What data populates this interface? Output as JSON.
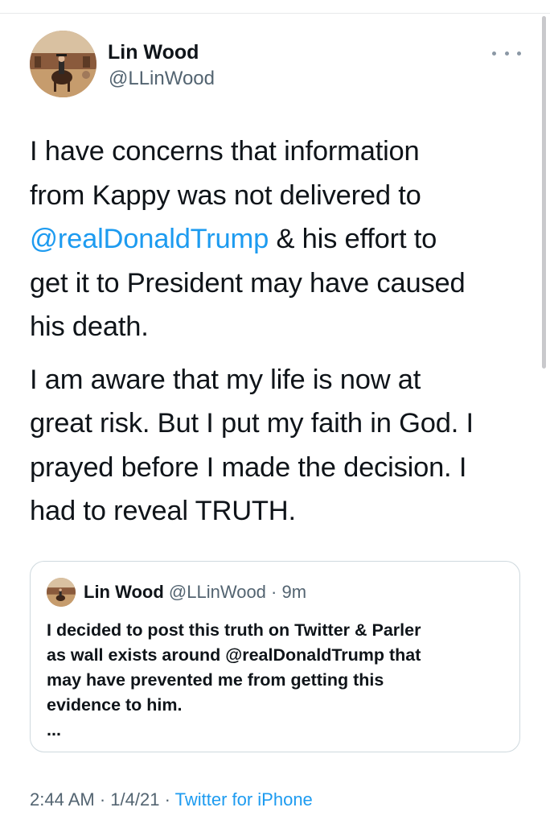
{
  "author": {
    "name": "Lin Wood",
    "handle": "@LLinWood"
  },
  "tweet": {
    "paragraph1": {
      "line1": "I have concerns that information",
      "line2": "from Kappy was not delivered to",
      "line3_mention": "@realDonaldTrump",
      "line3_rest": " & his effort to",
      "line4": "get it to President may have caused",
      "line5": "his death."
    },
    "paragraph2": {
      "line1": "I am aware that my life is now at",
      "line2": "great risk. But I put my faith in God. I",
      "line3": "prayed before I made the decision. I",
      "line4": "had to reveal TRUTH."
    }
  },
  "quoted_tweet": {
    "name": "Lin Wood",
    "handle": "@LLinWood",
    "separator": " · ",
    "time": "9m",
    "lines": [
      "I decided to post this truth on Twitter & Parler",
      "as wall exists around @realDonaldTrump that",
      "may have prevented me from getting this",
      "evidence to him.",
      "..."
    ]
  },
  "footer": {
    "time": "2:44 AM",
    "separator1": " · ",
    "date": "1/4/21",
    "separator2": " · ",
    "source": "Twitter for iPhone"
  },
  "icons": {
    "more": "more-horizontal-icon"
  },
  "colors": {
    "link": "#1d9bf0",
    "secondary_text": "#536471",
    "primary_text": "#0f1419",
    "border": "#cfd9de"
  }
}
